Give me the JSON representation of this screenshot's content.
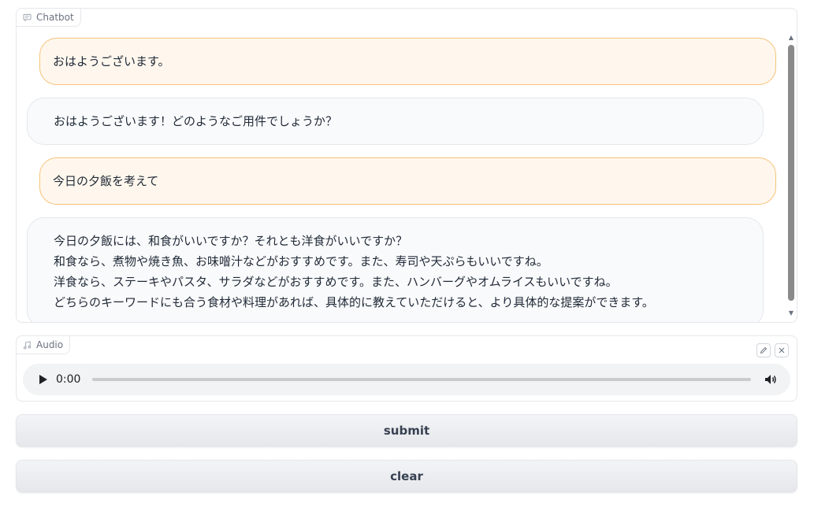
{
  "chatbot": {
    "label": "Chatbot",
    "messages": [
      {
        "role": "user",
        "text": "おはようございます。"
      },
      {
        "role": "bot",
        "text": "おはようございます！どのようなご用件でしょうか？"
      },
      {
        "role": "user",
        "text": "今日の夕飯を考えて"
      },
      {
        "role": "bot",
        "lines": [
          "今日の夕飯には、和食がいいですか？それとも洋食がいいですか？",
          "和食なら、煮物や焼き魚、お味噌汁などがおすすめです。また、寿司や天ぷらもいいですね。",
          "洋食なら、ステーキやパスタ、サラダなどがおすすめです。また、ハンバーグやオムライスもいいですね。",
          "どちらのキーワードにも合う食材や料理があれば、具体的に教えていただけると、より具体的な提案ができます。"
        ]
      }
    ]
  },
  "audio": {
    "label": "Audio",
    "time": "0:00",
    "progress": 0
  },
  "buttons": {
    "submit": "submit",
    "clear": "clear"
  },
  "icons": {
    "chat": "chat-icon",
    "music": "music-note-icon",
    "edit": "pencil-icon",
    "close": "close-icon",
    "play": "play-icon",
    "volume": "volume-icon"
  }
}
